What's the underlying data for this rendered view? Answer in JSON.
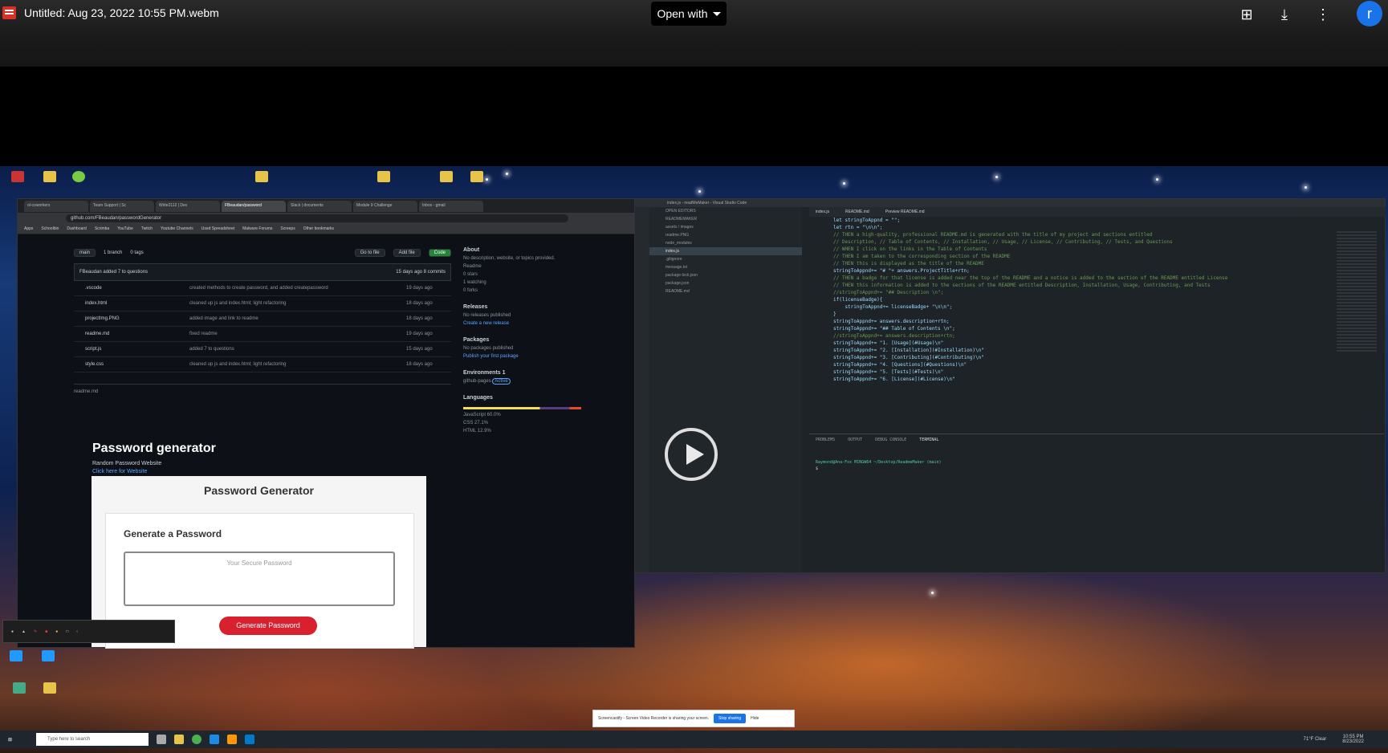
{
  "viewer": {
    "file_title": "Untitled: Aug 23, 2022 10:55 PM.webm",
    "open_with_label": "Open with",
    "avatar_initial": "r"
  },
  "browser": {
    "tabs": [
      "ol-coworkers",
      "Team Support | Sc",
      "Write2112 | Dev",
      "FBeaudan/password",
      "Slack | documents",
      "Module 9 Challenge",
      "Inbox - gmail"
    ],
    "url": "github.com/FBeaudan/passwordGenerator",
    "bookmarks": [
      "Apps",
      "Schoolbin",
      "Dashboard",
      "Scrimba",
      "YouTube",
      "Twitch",
      "Youtube Channels",
      "Used Spreadsheet",
      "Malware Forums",
      "Screeps",
      "Other bookmarks"
    ],
    "branch": "main",
    "branches": "1 branch",
    "tags": "0 tags",
    "go_to_file": "Go to file",
    "add_file": "Add file",
    "code": "Code",
    "commit_msg": "FBeaudan added 7 to questions",
    "commit_meta": "15 days ago  8 commits",
    "files": [
      {
        "name": ".vscode",
        "msg": "created methods to create password, and added createpassword",
        "age": "19 days ago"
      },
      {
        "name": "index.html",
        "msg": "cleaned up js and index.html; light refactoring",
        "age": "18 days ago"
      },
      {
        "name": "projectImg.PNG",
        "msg": "added image and link to readme",
        "age": "18 days ago"
      },
      {
        "name": "readme.md",
        "msg": "fixed readme",
        "age": "19 days ago"
      },
      {
        "name": "script.js",
        "msg": "added 7 to questions",
        "age": "15 days ago"
      },
      {
        "name": "style.css",
        "msg": "cleaned up js and index.html; light refactoring",
        "age": "18 days ago"
      }
    ],
    "readme_file": "readme.md",
    "readme_title": "Password generator",
    "readme_sub": "Random Password Website",
    "readme_link": "Click here for Website",
    "app_title": "Password Generator",
    "card_heading": "Generate a Password",
    "pw_placeholder": "Your Secure Password",
    "generate_label": "Generate Password",
    "about_head": "About",
    "about_text": "No description, website, or topics provided.",
    "about_items": [
      "Readme",
      "0 stars",
      "1 watching",
      "0 forks"
    ],
    "releases_head": "Releases",
    "releases_text": "No releases published",
    "releases_link": "Create a new release",
    "packages_head": "Packages",
    "packages_text": "No packages published",
    "packages_link": "Publish your first package",
    "env_head": "Environments",
    "env_count": "1",
    "env_item": "github-pages",
    "env_badge": "Active",
    "lang_head": "Languages",
    "langs": [
      "JavaScript 60.0%",
      "CSS 27.1%",
      "HTML 12.9%"
    ]
  },
  "vscode": {
    "title": "index.js - readMeMaker - Visual Studio Code",
    "tabs": [
      "index.js",
      "README.md",
      "Preview README.md"
    ],
    "explorer": [
      "OPEN EDITORS",
      "READMEMAKER",
      "assets \\ images",
      "readme.PNG",
      "node_modules",
      "index.js",
      ".gitignore",
      "message.txt",
      "package-lock.json",
      "package.json",
      "README.md"
    ],
    "code_lines": [
      "let stringToAppnd = \"\";",
      "let rtn = \"\\n\\n\";",
      "// THEN a high-quality, professional README.md is generated with the title of my project and sections entitled",
      "// Description, // Table of Contents, // Installation, // Usage, // License, // Contributing, // Tests, and Questions",
      "// WHEN I click on the links in the Table of Contents",
      "// THEN I am taken to the corresponding section of the README",
      "",
      "// THEN this is displayed as the title of the README",
      "stringToAppnd+= \"# \"+ answers.ProjectTitle+rtn;",
      "",
      "// THEN a badge for that license is added near the top of the README and a notice is added to the section of the README entitled License",
      "",
      "// THEN this information is added to the sections of the README entitled Description, Installation, Usage, Contributing, and Tests",
      "//stringToAppnd+= \"## Description \\n\";",
      "if(licenseBadge){",
      "    stringToAppnd+= licenseBadge+ \"\\n\\n\";",
      "}",
      "",
      "stringToAppnd+= answers.description+rtn;",
      "",
      "stringToAppnd+= \"## Table of Contents \\n\";",
      "//stringToAppnd+= answers.description+rtn;",
      "stringToAppnd+= \"1. [Usage](#Usage)\\n\"",
      "stringToAppnd+= \"2. [Installation](#Installation)\\n\"",
      "stringToAppnd+= \"3. [Contributing](#Contributing)\\n\"",
      "stringToAppnd+= \"4. [Questions](#Questions)\\n\"",
      "stringToAppnd+= \"5. [Tests](#Tests)\\n\"",
      "stringToAppnd+= \"6. [License](#License)\\n\""
    ],
    "terminal_tabs": [
      "PROBLEMS",
      "OUTPUT",
      "DEBUG CONSOLE",
      "TERMINAL"
    ],
    "terminal_prompt": "Raymond@Ana-Fox MINGW64 ~/Desktop/ReadmeMaker (main)",
    "terminal_line": "$ "
  },
  "desktop": {
    "share_text": "Screencastify - Screen Video Recorder is sharing your screen.",
    "stop_sharing": "Stop sharing",
    "hide": "Hide",
    "search_placeholder": "Type here to search",
    "time": "10:55 PM",
    "date": "8/23/2022",
    "weather": "71°F  Clear"
  }
}
